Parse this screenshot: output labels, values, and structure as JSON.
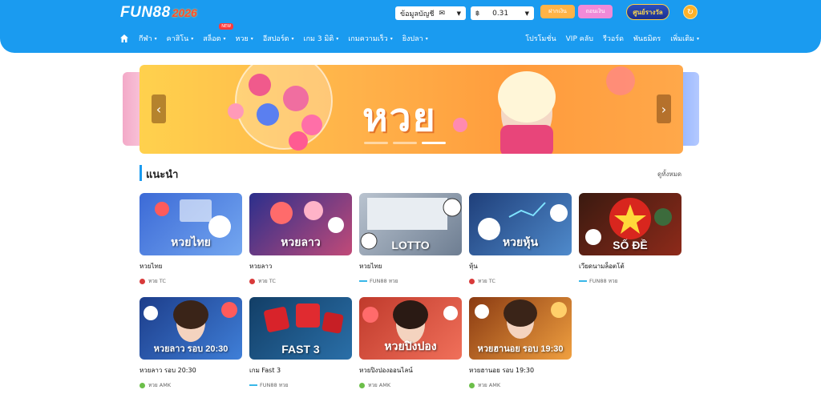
{
  "header": {
    "logo_main": "FUN88",
    "logo_year": "2026",
    "account_label": "ข้อมูลบัญชี",
    "balance_currency": "฿",
    "balance_value": "0.31",
    "deposit_label": "ฝากเงิน",
    "withdraw_label": "ถอนเงิน",
    "reward_label": "ศูนย์รางวัล"
  },
  "nav": {
    "items": [
      {
        "label": "กีฬา"
      },
      {
        "label": "คาสิโน"
      },
      {
        "label": "สล็อต",
        "badge": "NEW"
      },
      {
        "label": "หวย"
      },
      {
        "label": "อีสปอร์ต"
      },
      {
        "label": "เกม 3 มิติ"
      },
      {
        "label": "เกมความเร็ว"
      },
      {
        "label": "ยิงปลา"
      }
    ],
    "right_items": [
      {
        "label": "โปรโมชั่น"
      },
      {
        "label": "VIP คลับ"
      },
      {
        "label": "รีวอร์ด"
      },
      {
        "label": "พันธมิตร"
      },
      {
        "label": "เพิ่มเติม"
      }
    ]
  },
  "banner": {
    "title": "หวย",
    "slide_count": 3,
    "active_slide": 3
  },
  "section": {
    "title": "แนะนำ",
    "see_all": "ดูทั้งหมด"
  },
  "games": [
    {
      "title": "หวยไทย",
      "provider": "หวย TC",
      "image_label": "หวยไทย",
      "bg": "#3c6ad6"
    },
    {
      "title": "หวยลาว",
      "provider": "หวย TC",
      "image_label": "หวยลาว",
      "bg": "#2b2f8c"
    },
    {
      "title": "หวยไทย",
      "provider": "FUN88 หวย",
      "image_label": "LOTTO",
      "bg": "#9aa8b8"
    },
    {
      "title": "หุ้น",
      "provider": "หวย TC",
      "image_label": "หวยหุ้น",
      "bg": "#1f3f7a"
    },
    {
      "title": "เวียดนามล็อตโต้",
      "provider": "FUN88 หวย",
      "image_label": "SỐ ĐỀ",
      "bg": "#6e1d14"
    },
    {
      "title": "หวยลาว รอบ 20:30",
      "provider": "หวย AMK",
      "image_label": "หวยลาว รอบ 20:30",
      "bg": "#1d3d8a"
    },
    {
      "title": "เกม Fast 3",
      "provider": "FUN88 หวย",
      "image_label": "FAST 3",
      "bg": "#1a4f7e"
    },
    {
      "title": "หวยปิงปองออนไลน์",
      "provider": "หวย AMK",
      "image_label": "หวยปิงปอง",
      "bg": "#c03a2c"
    },
    {
      "title": "หวยฮานอย รอบ 19:30",
      "provider": "หวย AMK",
      "image_label": "หวยฮานอย รอบ 19:30",
      "bg": "#c46a1c"
    }
  ]
}
